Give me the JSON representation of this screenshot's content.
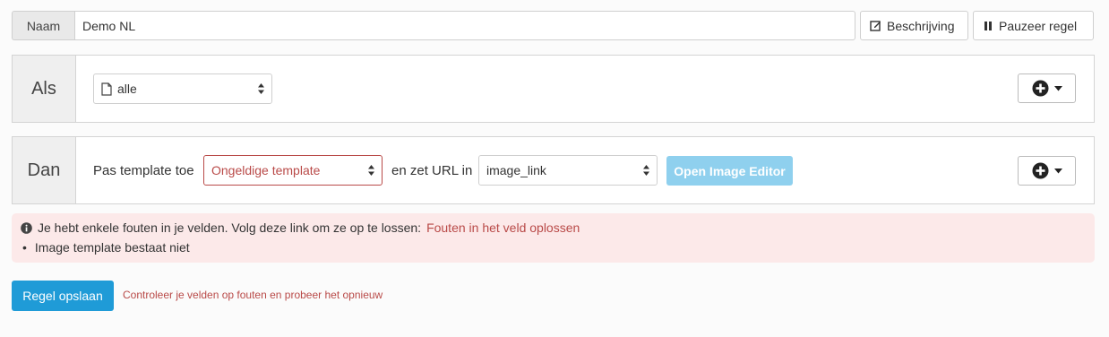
{
  "rule_name": {
    "label": "Naam",
    "value": "Demo NL"
  },
  "toolbar": {
    "description_label": "Beschrijving",
    "pause_label": "Pauzeer regel"
  },
  "if_block": {
    "label": "Als",
    "select_value": "alle"
  },
  "then_block": {
    "label": "Dan",
    "apply_text": "Pas template toe",
    "template_value": "Ongeldige template",
    "url_text": "en zet URL in",
    "url_value": "image_link",
    "editor_label": "Open Image Editor"
  },
  "alert": {
    "message": "Je hebt enkele fouten in je velden. Volg deze link om ze op te lossen:",
    "link_text": "Fouten in het veld oplossen",
    "errors": [
      "Image template bestaat niet"
    ]
  },
  "footer": {
    "save_label": "Regel opslaan",
    "hint": "Controleer je velden op fouten en probeer het opnieuw"
  },
  "colors": {
    "error": "#b94a48",
    "primary": "#1f9bd7",
    "editor_button": "#8fd0ee",
    "alert_bg": "#fce9e9"
  },
  "icons": {
    "description": "edit-icon",
    "pause": "pause-icon",
    "document": "file-icon",
    "add": "plus-circle-icon",
    "caret": "caret-down-icon",
    "select_arrows": "sort-icon",
    "info": "info-circle-icon"
  }
}
